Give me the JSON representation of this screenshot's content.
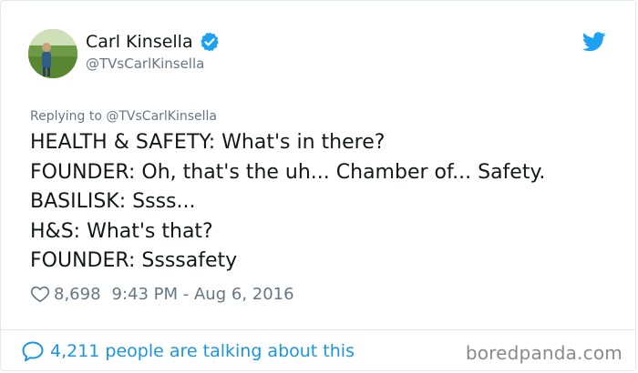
{
  "header": {
    "display_name": "Carl Kinsella",
    "handle": "@TVsCarlKinsella",
    "avatar_icon": "person-in-field-avatar",
    "verified_icon": "verified-badge-icon",
    "brand_icon": "twitter-bird-icon",
    "brand_color": "#1da1f2"
  },
  "tweet": {
    "reply_prefix": "Replying to @TVsCarlKinsella",
    "lines": [
      "HEALTH & SAFETY: What's in there?",
      "FOUNDER: Oh, that's the uh... Chamber of... Safety.",
      "BASILISK: Ssss...",
      "H&S: What's that?",
      "FOUNDER: Ssssafety"
    ],
    "likes": "8,698",
    "timestamp": "9:43 PM - Aug 6, 2016",
    "like_icon": "heart-outline-icon"
  },
  "footer": {
    "talking_text": "4,211 people are talking about this",
    "talking_icon": "speech-bubble-icon",
    "talking_color": "#1b95e0",
    "watermark": "boredpanda.com"
  }
}
